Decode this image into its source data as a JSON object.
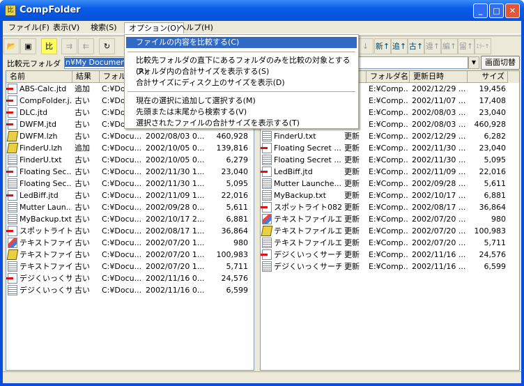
{
  "window": {
    "title": "CompFolder",
    "min": "_",
    "max": "□",
    "close": "✕"
  },
  "menubar": [
    {
      "label": "ファイル(F)"
    },
    {
      "label": "表示(V)"
    },
    {
      "label": "検索(S)"
    },
    {
      "label": "オプション(O)"
    },
    {
      "label": "ヘルプ(H)"
    }
  ],
  "options_menu": {
    "items": [
      {
        "label": "ファイルの内容を比較する(C)",
        "selected": true
      },
      {
        "label": "比較先フォルダの直下にあるフォルダのみを比較の対象とする(R)"
      },
      {
        "label": "フォルダ内の合計サイズを表示する(S)"
      },
      {
        "label": "合計サイズにディスク上のサイズを表示(D)"
      },
      {
        "label": "現在の選択に追加して選択する(M)"
      },
      {
        "label": "先頭または末尾から検索する(V)"
      },
      {
        "label": "選択されたファイルの合計サイズを表示する(T)"
      }
    ]
  },
  "toolbar": {
    "compare": "比",
    "sort_new": "新↑",
    "sort_add": "追↑",
    "sort_old": "古↑",
    "sort_diff": "違↑",
    "sort_edit": "編↑",
    "sort_name": "留↑",
    "sort_err": "ｴﾗｰ↑"
  },
  "source": {
    "label": "比較元フォルダ",
    "value": "n¥My Documents"
  },
  "dest": {
    "value": "e",
    "switch_button": "画面切替"
  },
  "left": {
    "columns": [
      "名前",
      "結果",
      "フォルダ",
      "更新日時",
      "サイズ"
    ],
    "rows": [
      {
        "icon": "jtd",
        "name": "ABS-Calc.jtd",
        "result": "追加",
        "folder": "C:¥Do",
        "date": "",
        "size": ""
      },
      {
        "icon": "jtd",
        "name": "CompFolder.j...",
        "result": "古い",
        "folder": "C:¥Do",
        "date": "",
        "size": ""
      },
      {
        "icon": "jtd",
        "name": "DLC.jtd",
        "result": "古い",
        "folder": "C:¥Do",
        "date": "",
        "size": ""
      },
      {
        "icon": "jtd",
        "name": "DWFM.jtd",
        "result": "古い",
        "folder": "C:¥Do",
        "date": "",
        "size": ""
      },
      {
        "icon": "lzh",
        "name": "DWFM.lzh",
        "result": "古い",
        "folder": "C:¥Docu...",
        "date": "2002/08/03 0...",
        "size": "460,928"
      },
      {
        "icon": "lzh",
        "name": "FinderU.lzh",
        "result": "追加",
        "folder": "C:¥Docu...",
        "date": "2002/10/05 0...",
        "size": "139,816"
      },
      {
        "icon": "txt",
        "name": "FinderU.txt",
        "result": "古い",
        "folder": "C:¥Docu...",
        "date": "2002/10/05 0...",
        "size": "6,279"
      },
      {
        "icon": "jtd",
        "name": "Floating Sec...",
        "result": "古い",
        "folder": "C:¥Docu...",
        "date": "2002/11/30 1...",
        "size": "23,040"
      },
      {
        "icon": "txt",
        "name": "Floating Sec...",
        "result": "古い",
        "folder": "C:¥Docu...",
        "date": "2002/11/30 1...",
        "size": "5,095"
      },
      {
        "icon": "jtd",
        "name": "LedBiff.jtd",
        "result": "古い",
        "folder": "C:¥Docu...",
        "date": "2002/11/09 1...",
        "size": "22,016"
      },
      {
        "icon": "txt",
        "name": "Mutter Laun...",
        "result": "古い",
        "folder": "C:¥Docu...",
        "date": "2002/09/28 0...",
        "size": "5,611"
      },
      {
        "icon": "txt",
        "name": "MyBackup.txt",
        "result": "古い",
        "folder": "C:¥Docu...",
        "date": "2002/10/17 2...",
        "size": "6,881"
      },
      {
        "icon": "jtd",
        "name": "スポットライト0...",
        "result": "古い",
        "folder": "C:¥Docu...",
        "date": "2002/08/17 1...",
        "size": "36,864"
      },
      {
        "icon": "img",
        "name": "テキストファイ...",
        "result": "古い",
        "folder": "C:¥Docu...",
        "date": "2002/07/20 1...",
        "size": "980"
      },
      {
        "icon": "lzh",
        "name": "テキストファイ...",
        "result": "古い",
        "folder": "C:¥Docu...",
        "date": "2002/07/20 1...",
        "size": "100,983"
      },
      {
        "icon": "txt",
        "name": "テキストファイ...",
        "result": "古い",
        "folder": "C:¥Docu...",
        "date": "2002/07/20 1...",
        "size": "5,711"
      },
      {
        "icon": "jtd",
        "name": "デジくいっくサ...",
        "result": "古い",
        "folder": "C:¥Docu...",
        "date": "2002/11/16 0...",
        "size": "24,576"
      },
      {
        "icon": "txt",
        "name": "デジくいっくサ...",
        "result": "古い",
        "folder": "C:¥Docu...",
        "date": "2002/11/16 0...",
        "size": "6,599"
      }
    ]
  },
  "right": {
    "columns": [
      "",
      "",
      "フォルダ名",
      "更新日時",
      "サイズ"
    ],
    "rows": [
      {
        "icon": "",
        "name": "",
        "result": "",
        "folder": "E:¥Comp...",
        "date": "2002/12/29 ...",
        "size": "19,456"
      },
      {
        "icon": "",
        "name": "",
        "result": "",
        "folder": "E:¥Comp...",
        "date": "2002/11/07 ...",
        "size": "17,408"
      },
      {
        "icon": "",
        "name": "",
        "result": "",
        "folder": "E:¥Comp...",
        "date": "2002/08/03 ...",
        "size": "23,040"
      },
      {
        "icon": "",
        "name": "",
        "result": "",
        "folder": "E:¥Comp...",
        "date": "2002/08/03 ...",
        "size": "460,928"
      },
      {
        "icon": "txt",
        "name": "FinderU.txt",
        "result": "更新",
        "folder": "E:¥Comp...",
        "date": "2002/12/29 ...",
        "size": "6,282"
      },
      {
        "icon": "jtd",
        "name": "Floating Secret ...",
        "result": "更新",
        "folder": "E:¥Comp...",
        "date": "2002/11/30 ...",
        "size": "23,040"
      },
      {
        "icon": "txt",
        "name": "Floating Secret ...",
        "result": "更新",
        "folder": "E:¥Comp...",
        "date": "2002/11/30 ...",
        "size": "5,095"
      },
      {
        "icon": "jtd",
        "name": "LedBiff.jtd",
        "result": "更新",
        "folder": "E:¥Comp...",
        "date": "2002/11/09 ...",
        "size": "22,016"
      },
      {
        "icon": "txt",
        "name": "Mutter Launche...",
        "result": "更新",
        "folder": "E:¥Comp...",
        "date": "2002/09/28 ...",
        "size": "5,611"
      },
      {
        "icon": "txt",
        "name": "MyBackup.txt",
        "result": "更新",
        "folder": "E:¥Comp...",
        "date": "2002/10/17 ...",
        "size": "6,881"
      },
      {
        "icon": "jtd",
        "name": "スポットライト082...",
        "result": "更新",
        "folder": "E:¥Comp...",
        "date": "2002/08/17 ...",
        "size": "36,864"
      },
      {
        "icon": "img",
        "name": "テキストファイルエ...",
        "result": "更新",
        "folder": "E:¥Comp...",
        "date": "2002/07/20 ...",
        "size": "980"
      },
      {
        "icon": "lzh",
        "name": "テキストファイルエ...",
        "result": "更新",
        "folder": "E:¥Comp...",
        "date": "2002/07/20 ...",
        "size": "100,983"
      },
      {
        "icon": "txt",
        "name": "テキストファイルエ...",
        "result": "更新",
        "folder": "E:¥Comp...",
        "date": "2002/07/20 ...",
        "size": "5,711"
      },
      {
        "icon": "jtd",
        "name": "デジくいっくサーチ...",
        "result": "更新",
        "folder": "E:¥Comp...",
        "date": "2002/11/16 ...",
        "size": "24,576"
      },
      {
        "icon": "txt",
        "name": "デジくいっくサーチ...",
        "result": "更新",
        "folder": "E:¥Comp...",
        "date": "2002/11/16 ...",
        "size": "6,599"
      }
    ]
  },
  "colors": {
    "titlebar": "#0a5ce8",
    "selection": "#316ac5",
    "face": "#ece9d8"
  }
}
